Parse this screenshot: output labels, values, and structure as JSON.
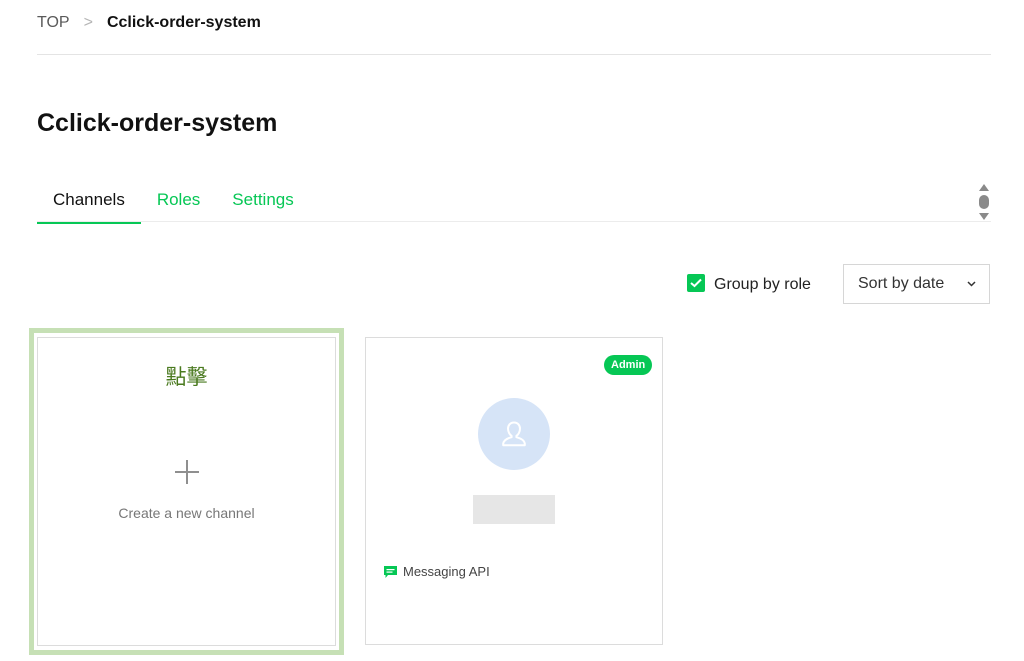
{
  "breadcrumb": {
    "root": "TOP",
    "separator": ">",
    "current": "Cclick-order-system"
  },
  "page": {
    "title": "Cclick-order-system"
  },
  "tabs": [
    {
      "label": "Channels",
      "active": true
    },
    {
      "label": "Roles",
      "active": false
    },
    {
      "label": "Settings",
      "active": false
    }
  ],
  "controls": {
    "group_by_role_label": "Group by role",
    "group_by_role_checked": true,
    "sort_value": "Sort by date"
  },
  "create_card": {
    "annotation": "點擊",
    "label": "Create a new channel"
  },
  "channel_card": {
    "badge": "Admin",
    "type_label": "Messaging API"
  },
  "colors": {
    "accent": "#06c755",
    "annotation_highlight": "#c6e0b5",
    "annotation_text": "#4a7a1f",
    "avatar_bg": "#d6e4f7"
  }
}
